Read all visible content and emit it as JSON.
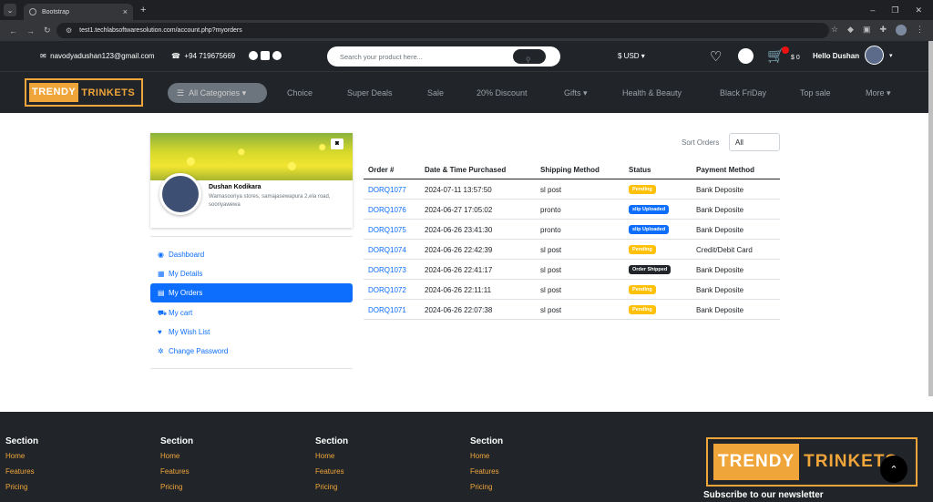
{
  "browser": {
    "tab_title": "Bootstrap",
    "url": "test1.techlabsoftwaresolution.com/account.php?myorders"
  },
  "topbar": {
    "email": "navodyadushan123@gmail.com",
    "phone": "+94 719675669",
    "search_placeholder": "Search your product here...",
    "currency": "$ USD",
    "cart_amount": "$ 0",
    "greeting": "Hello Dushan"
  },
  "navbar": {
    "logo_a": "TRENDY",
    "logo_b": "TRINKETS",
    "all_categories": "All Categories",
    "links": [
      "Choice",
      "Super Deals",
      "Sale",
      "20% Discount",
      "Gifts",
      "Health & Beauty",
      "Black FriDay",
      "Top sale",
      "More"
    ]
  },
  "profile": {
    "name": "Dushan Kodikara",
    "address": "Warnasooriya stores, samajasewapura 2,ela road, sooriyawewa"
  },
  "sidemenu": [
    {
      "label": "Dashboard",
      "icon": "tachometer-icon"
    },
    {
      "label": "My Details",
      "icon": "calendar-icon"
    },
    {
      "label": "My Orders",
      "icon": "list-icon"
    },
    {
      "label": "My cart",
      "icon": "cart-icon"
    },
    {
      "label": "My Wish List",
      "icon": "heart-icon"
    },
    {
      "label": "Change Password",
      "icon": "gear-icon"
    }
  ],
  "orders": {
    "sort_label": "Sort Orders",
    "sort_value": "All",
    "headers": [
      "Order #",
      "Date & Time Purchased",
      "Shipping Method",
      "Status",
      "Payment Method"
    ],
    "rows": [
      {
        "id": "DORQ1077",
        "date": "2024-07-11 13:57:50",
        "shipping": "sl post",
        "status": "Pending",
        "payment": "Bank Deposite"
      },
      {
        "id": "DORQ1076",
        "date": "2024-06-27 17:05:02",
        "shipping": "pronto",
        "status": "slip Uploaded",
        "payment": "Bank Deposite"
      },
      {
        "id": "DORQ1075",
        "date": "2024-06-26 23:41:30",
        "shipping": "pronto",
        "status": "slip Uploaded",
        "payment": "Bank Deposite"
      },
      {
        "id": "DORQ1074",
        "date": "2024-06-26 22:42:39",
        "shipping": "sl post",
        "status": "Pending",
        "payment": "Credit/Debit Card"
      },
      {
        "id": "DORQ1073",
        "date": "2024-06-26 22:41:17",
        "shipping": "sl post",
        "status": "Order Shipped",
        "payment": "Bank Deposite"
      },
      {
        "id": "DORQ1072",
        "date": "2024-06-26 22:11:11",
        "shipping": "sl post",
        "status": "Pending",
        "payment": "Bank Deposite"
      },
      {
        "id": "DORQ1071",
        "date": "2024-06-26 22:07:38",
        "shipping": "sl post",
        "status": "Pending",
        "payment": "Bank Deposite"
      }
    ]
  },
  "footer": {
    "columns": [
      {
        "heading": "Section",
        "links": [
          "Home",
          "Features",
          "Pricing"
        ]
      },
      {
        "heading": "Section",
        "links": [
          "Home",
          "Features",
          "Pricing"
        ]
      },
      {
        "heading": "Section",
        "links": [
          "Home",
          "Features",
          "Pricing"
        ]
      },
      {
        "heading": "Section",
        "links": [
          "Home",
          "Features",
          "Pricing"
        ]
      }
    ],
    "logo_a": "TRENDY",
    "logo_b": "TRINKETS",
    "subscribe": "Subscribe to our newsletter"
  },
  "colors": {
    "accent": "#f0a53a",
    "dark": "#212529",
    "primary": "#0d6efd",
    "warning": "#ffc107"
  }
}
